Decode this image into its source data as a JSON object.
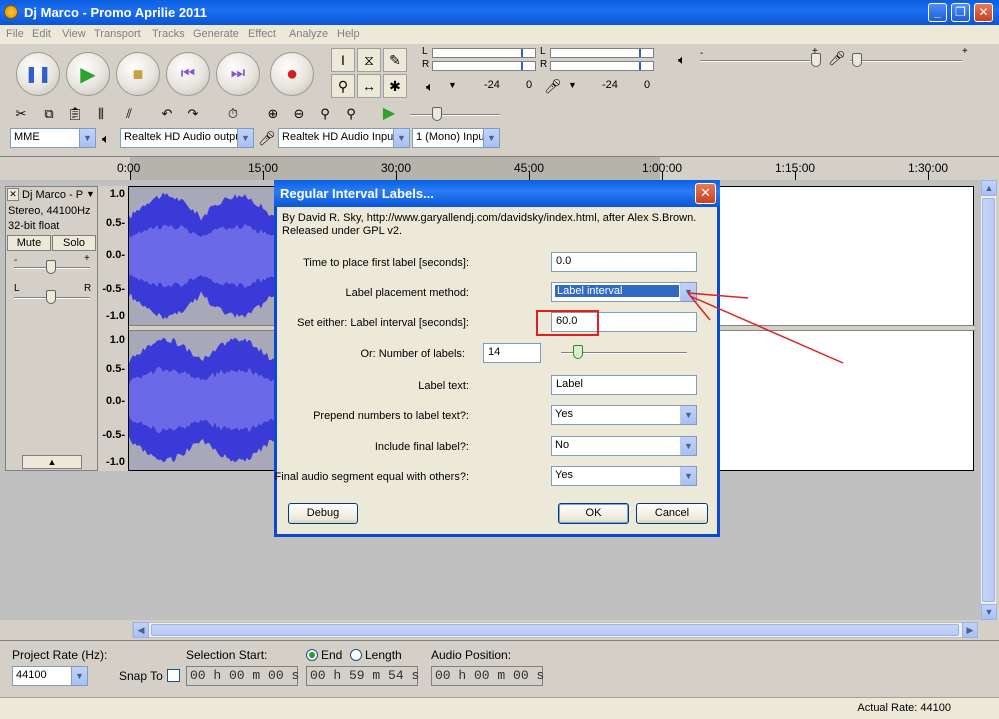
{
  "window": {
    "title": "Dj Marco - Promo Aprilie 2011",
    "minimize": "_",
    "maximize": "❐",
    "close": "✕"
  },
  "menu": [
    "File",
    "Edit",
    "View",
    "Transport",
    "Tracks",
    "Generate",
    "Effect",
    "Analyze",
    "Help"
  ],
  "meters": {
    "left": "L",
    "right": "R",
    "scale_a_left": "-24",
    "scale_a_right": "0",
    "scale_b_left": "-24",
    "scale_b_right": "0"
  },
  "mixer": {
    "minus": "-",
    "plus": "+"
  },
  "devices": {
    "host": "MME",
    "output": "Realtek HD Audio outpu",
    "input": "Realtek HD Audio Input",
    "channels": "1 (Mono) Inpu"
  },
  "ruler": {
    "labels": [
      "0:00",
      "15:00",
      "30:00",
      "45:00",
      "1:00:00",
      "1:15:00",
      "1:30:00"
    ]
  },
  "track": {
    "name": "Dj Marco - P",
    "close": "✕",
    "format": "Stereo, 44100Hz",
    "depth": "32-bit float",
    "mute": "Mute",
    "solo": "Solo",
    "gain_minus": "-",
    "gain_plus": "+",
    "pan_left": "L",
    "pan_right": "R",
    "collapse": "▲",
    "yaxis": [
      "1.0",
      "0.5-",
      "0.0-",
      "-0.5-",
      "-1.0"
    ]
  },
  "dialog": {
    "title": "Regular Interval Labels...",
    "close": "✕",
    "credit": "By David R. Sky, http://www.garyallendj.com/davidsky/index.html, after Alex S.Brown. Released under GPL v2.",
    "fields": {
      "first_label": {
        "label": "Time to place first label [seconds]:",
        "value": "0.0"
      },
      "placement": {
        "label": "Label placement method:",
        "value": "Label interval"
      },
      "interval": {
        "label": "Set either: Label interval [seconds]:",
        "value": "60.0"
      },
      "num_labels": {
        "label": "Or: Number of labels:",
        "value": "14"
      },
      "label_text": {
        "label": "Label text:",
        "value": "Label"
      },
      "prepend": {
        "label": "Prepend numbers to label text?:",
        "value": "Yes"
      },
      "include_final": {
        "label": "Include final label?:",
        "value": "No"
      },
      "final_segment": {
        "label": "Final audio segment equal with others?:",
        "value": "Yes"
      }
    },
    "buttons": {
      "debug": "Debug",
      "ok": "OK",
      "cancel": "Cancel"
    }
  },
  "bottom": {
    "project_rate_label": "Project Rate (Hz):",
    "project_rate": "44100",
    "snap_to": "Snap To",
    "selection_start_label": "Selection Start:",
    "end_label": "End",
    "length_label": "Length",
    "audio_position_label": "Audio Position:",
    "selection_start": "00 h 00 m 00 s",
    "selection_end": "00 h 59 m 54 s",
    "audio_position": "00 h 00 m 00 s"
  },
  "status": {
    "actual_rate": "Actual Rate: 44100"
  },
  "colors": {
    "titlebar": "#0a5fe0",
    "waveform": "#3a3ad8",
    "waveform_rms": "#6a6ae8",
    "selection": "#a8a8b8",
    "annotation": "#e02020"
  }
}
